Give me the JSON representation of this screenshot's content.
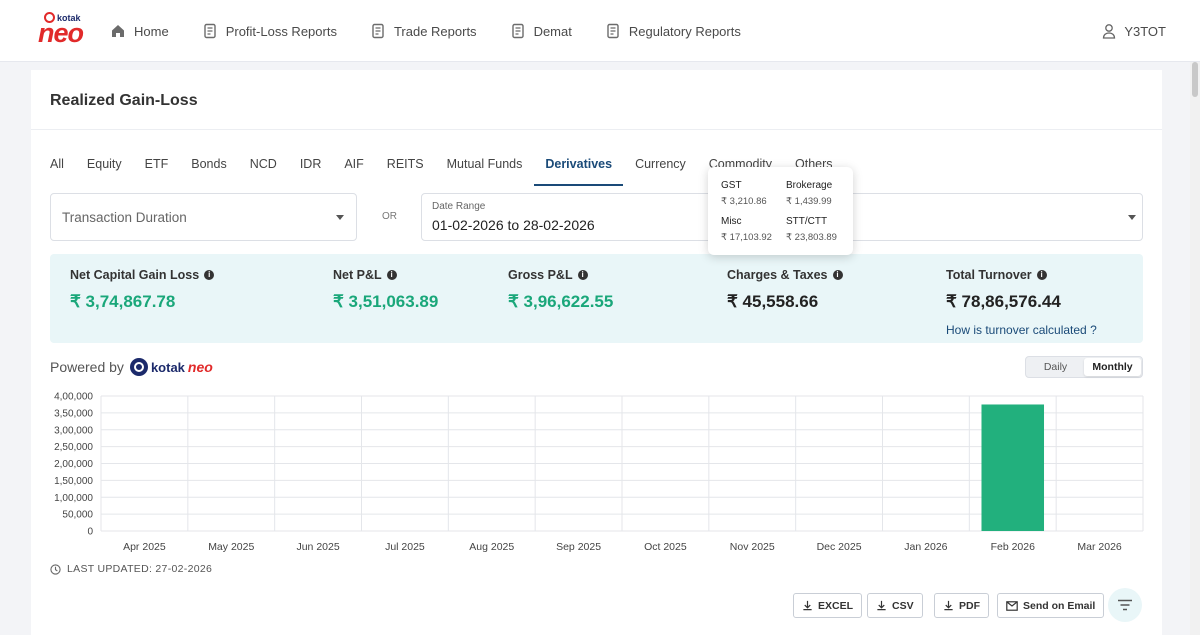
{
  "brand": {
    "small": "kotak",
    "big": "neo",
    "powered_by": "Powered by",
    "powered_kotak": "kotak",
    "powered_neo": "neo"
  },
  "nav": {
    "items": [
      "Home",
      "Profit-Loss Reports",
      "Trade Reports",
      "Demat",
      "Regulatory Reports"
    ],
    "user": "Y3TOT"
  },
  "page": {
    "title": "Realized Gain-Loss"
  },
  "tabs": {
    "items": [
      "All",
      "Equity",
      "ETF",
      "Bonds",
      "NCD",
      "IDR",
      "AIF",
      "REITS",
      "Mutual Funds",
      "Derivatives",
      "Currency",
      "Commodity",
      "Others"
    ],
    "active": "Derivatives"
  },
  "filters": {
    "duration_label": "Transaction Duration",
    "or": "OR",
    "date_caption": "Date Range",
    "date_value": "01-02-2026 to 28-02-2026"
  },
  "summary": {
    "net_capital_gain_loss": {
      "label": "Net Capital Gain Loss",
      "value": "₹ 3,74,867.78"
    },
    "net_pnl": {
      "label": "Net P&L",
      "value": "₹ 3,51,063.89"
    },
    "gross_pnl": {
      "label": "Gross P&L",
      "value": "₹ 3,96,622.55"
    },
    "charges_taxes": {
      "label": "Charges & Taxes",
      "value": "₹ 45,558.66"
    },
    "total_turnover": {
      "label": "Total Turnover",
      "value": "₹ 78,86,576.44",
      "link": "How is turnover calculated ?"
    }
  },
  "tooltip": {
    "gst_label": "GST",
    "gst_value": "₹ 3,210.86",
    "brokerage_label": "Brokerage",
    "brokerage_value": "₹ 1,439.99",
    "misc_label": "Misc",
    "misc_value": "₹ 17,103.92",
    "stt_label": "STT/CTT",
    "stt_value": "₹ 23,803.89"
  },
  "toggle": {
    "daily": "Daily",
    "monthly": "Monthly",
    "selected": "Monthly"
  },
  "chart_data": {
    "type": "bar",
    "categories": [
      "Apr 2025",
      "May 2025",
      "Jun 2025",
      "Jul 2025",
      "Aug 2025",
      "Sep 2025",
      "Oct 2025",
      "Nov 2025",
      "Dec 2025",
      "Jan 2026",
      "Feb 2026",
      "Mar 2026"
    ],
    "values": [
      0,
      0,
      0,
      0,
      0,
      0,
      0,
      0,
      0,
      0,
      374867.78,
      0
    ],
    "yticks": [
      "4,00,000",
      "3,50,000",
      "3,00,000",
      "2,50,000",
      "2,00,000",
      "1,50,000",
      "1,00,000",
      "50,000",
      "0"
    ],
    "ylim": [
      0,
      400000
    ],
    "grid": true,
    "bar_color": "#22b07d"
  },
  "last_updated": "LAST UPDATED: 27-02-2026",
  "actions": {
    "excel": "EXCEL",
    "csv": "CSV",
    "pdf": "PDF",
    "email": "Send on Email"
  },
  "icons": [
    "home-icon",
    "report-icon",
    "user-icon",
    "clock-icon",
    "download-icon",
    "mail-icon",
    "filter-icon",
    "info-icon",
    "chevron-down-icon"
  ]
}
